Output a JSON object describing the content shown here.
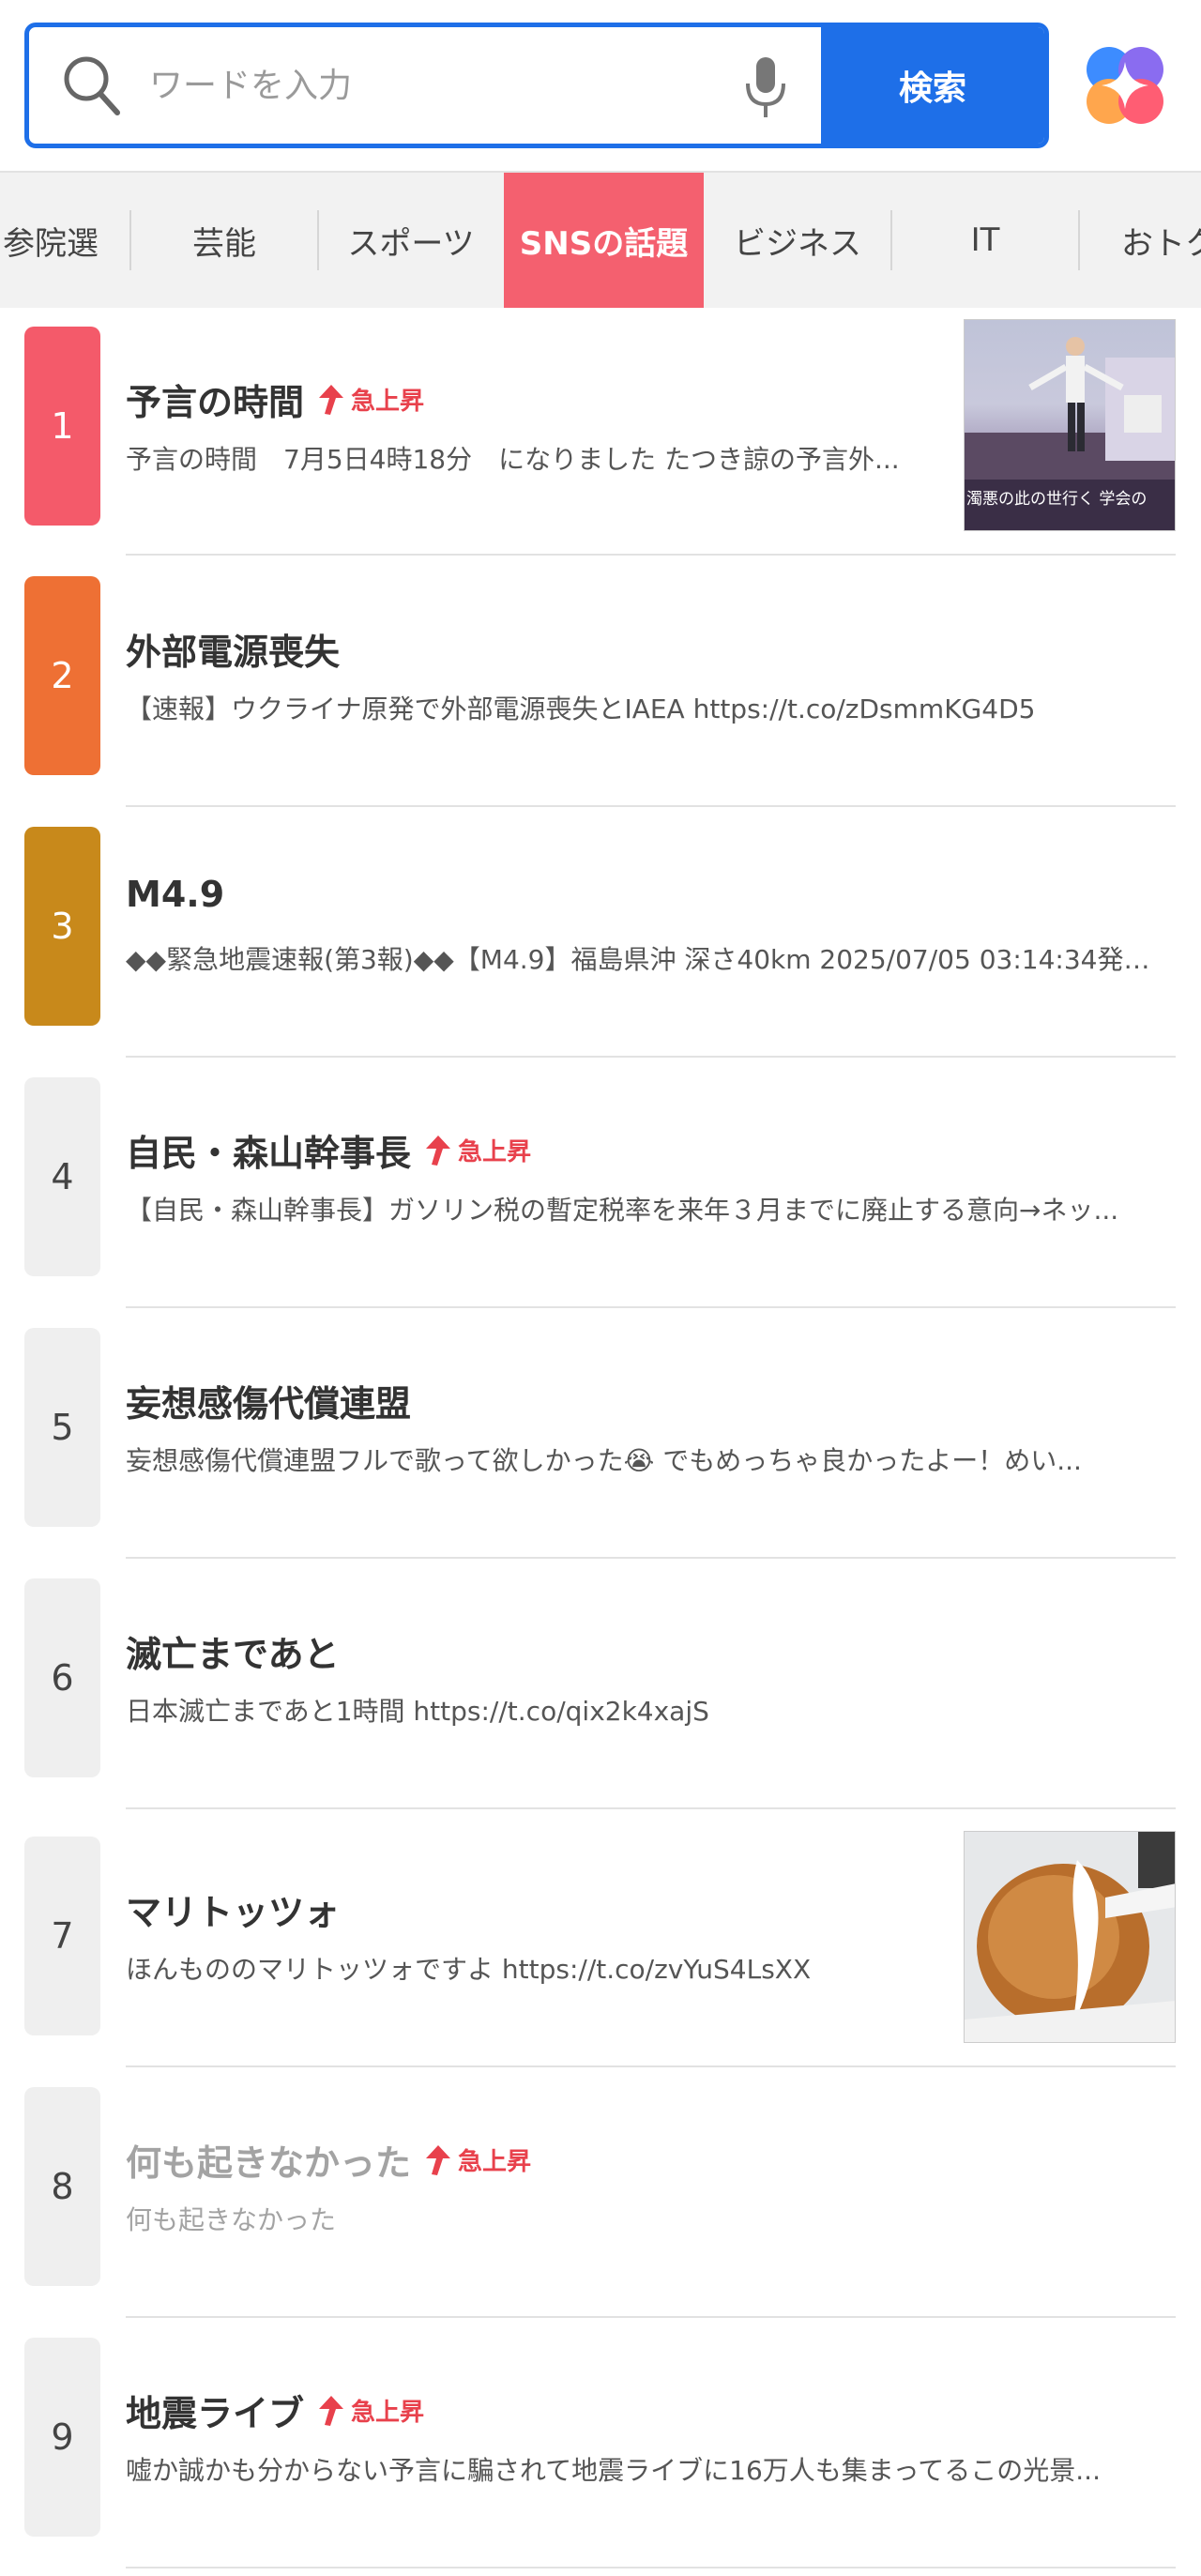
{
  "search": {
    "placeholder": "ワードを入力",
    "button_label": "検索"
  },
  "icons": {
    "search": "search-icon",
    "mic": "microphone-icon",
    "app": "app-logo-icon",
    "rising": "arrow-up-icon"
  },
  "colors": {
    "accent_blue": "#1e6fe8",
    "active_tab": "#f4606f",
    "rank1": "#f45a6a",
    "rank2": "#ee7034",
    "rank3": "#c8891b",
    "rank_default": "#efefef",
    "rising": "#e8414c"
  },
  "tabs": [
    {
      "label": "参院選"
    },
    {
      "label": "芸能"
    },
    {
      "label": "スポーツ"
    },
    {
      "label": "SNSの話題"
    },
    {
      "label": "ビジネス"
    },
    {
      "label": "IT"
    },
    {
      "label": "おトク"
    }
  ],
  "rising_label": "急上昇",
  "items": [
    {
      "rank": "1",
      "title": "予言の時間",
      "rising": true,
      "desc": "予言の時間　7月5日4時18分　になりました たつき諒の予言外..."
    },
    {
      "rank": "2",
      "title": "外部電源喪失",
      "rising": false,
      "desc": "【速報】ウクライナ原発で外部電源喪失とIAEA https://t.co/zDsmmKG4D5"
    },
    {
      "rank": "3",
      "title": "M4.9",
      "rising": false,
      "desc": "◆◆緊急地震速報(第3報)◆◆【M4.9】福島県沖 深さ40km 2025/07/05 03:14:34発生 ..."
    },
    {
      "rank": "4",
      "title": "自民・森山幹事長",
      "rising": true,
      "desc": "【自民・森山幹事長】ガソリン税の暫定税率を来年３月までに廃止する意向→ネッ..."
    },
    {
      "rank": "5",
      "title": "妄想感傷代償連盟",
      "rising": false,
      "desc": "妄想感傷代償連盟フルで歌って欲しかった😭 でもめっちゃ良かったよー！めい..."
    },
    {
      "rank": "6",
      "title": "滅亡まであと",
      "rising": false,
      "desc": "日本滅亡まであと1時間 https://t.co/qix2k4xajS"
    },
    {
      "rank": "7",
      "title": "マリトッツォ",
      "rising": false,
      "desc": "ほんもののマリトッツォですよ https://t.co/zvYuS4LsXX"
    },
    {
      "rank": "8",
      "title": "何も起きなかった",
      "rising": true,
      "desc": "何も起きなかった"
    },
    {
      "rank": "9",
      "title": "地震ライブ",
      "rising": true,
      "desc": "嘘か誠かも分からない予言に騙されて地震ライブに16万人も集まってるこの光景..."
    }
  ],
  "thumbnails": {
    "item1_caption": "濁悪の此の世行く 学会の"
  }
}
